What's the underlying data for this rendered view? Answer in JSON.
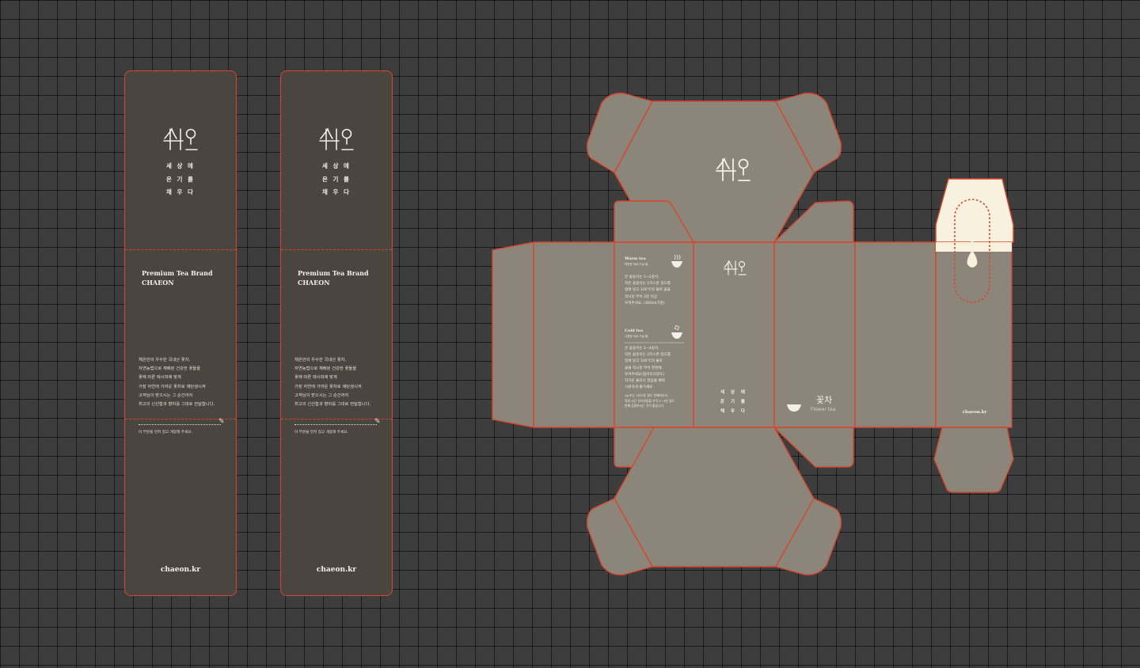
{
  "logo_text": "채온",
  "slogan": [
    "세 상 에",
    "온 기 를",
    "채 우 다"
  ],
  "brand": {
    "line1": "Premium Tea Brand",
    "line2": "CHAEON"
  },
  "description": [
    "채온만의 우수한 국내산 꽃차,",
    "자연농법으로 재배된 건강한 꽃들을",
    "꽃에 따른 레시피에 맞게",
    "가장 자연에 가까운 꽃차로 재탄생시켜",
    "고객님이 받으시는 그 순간까지",
    "최고의 신선함과 향미를 그대로 전달합니다."
  ],
  "tear_note": "이 부분을 먼저 접고 개봉해 주세요.",
  "website": "chaeon.kr",
  "warm_tea": {
    "title": "Warm tea",
    "subtitle": "따뜻한 차로 드실 때,",
    "body": [
      "큰 꽃송이는 1~2송이,",
      "작은 꽃송이는 1티스푼 정도를",
      "컵에 넣고 100℃의 물로 꽃을",
      "적시듯 부어 2분 이상",
      "우려주세요. (300ml기준)"
    ]
  },
  "cold_tea": {
    "title": "Cold tea",
    "subtitle": "시원한 차로 드실 때,",
    "body": [
      "큰 꽃송이는 2~4송이,",
      "작은 꽃송이는 2티스푼 정도를",
      "컵에 넣고 100℃의 물로",
      "꽃을 적시듯 부어 한번에",
      "우려주세요(접어도/5분도)",
      "차가운 물이나 얼음을 채워",
      "시원하게 즐기세요."
    ],
    "note": [
      "1g 또는 1티스푼 정도 천에따라서,",
      "적정 시간 차이양양을 우려 2~3번 정도",
      "번째 음용하시는 것이 좋습니다."
    ]
  },
  "product": {
    "name_ko": "꽃차",
    "name_en": "Flower tea"
  },
  "colors": {
    "background": "#3d3d3d",
    "strip_fill": "#4b4540",
    "box_fill": "#8b8679",
    "cut_line": "#d9452e",
    "tab_fill": "#f7f1dd",
    "text_light": "#f2efe9"
  },
  "icons": [
    "tea-bowl-icon",
    "steam-icon",
    "ice-icon",
    "pencil-icon",
    "drop-icon"
  ]
}
